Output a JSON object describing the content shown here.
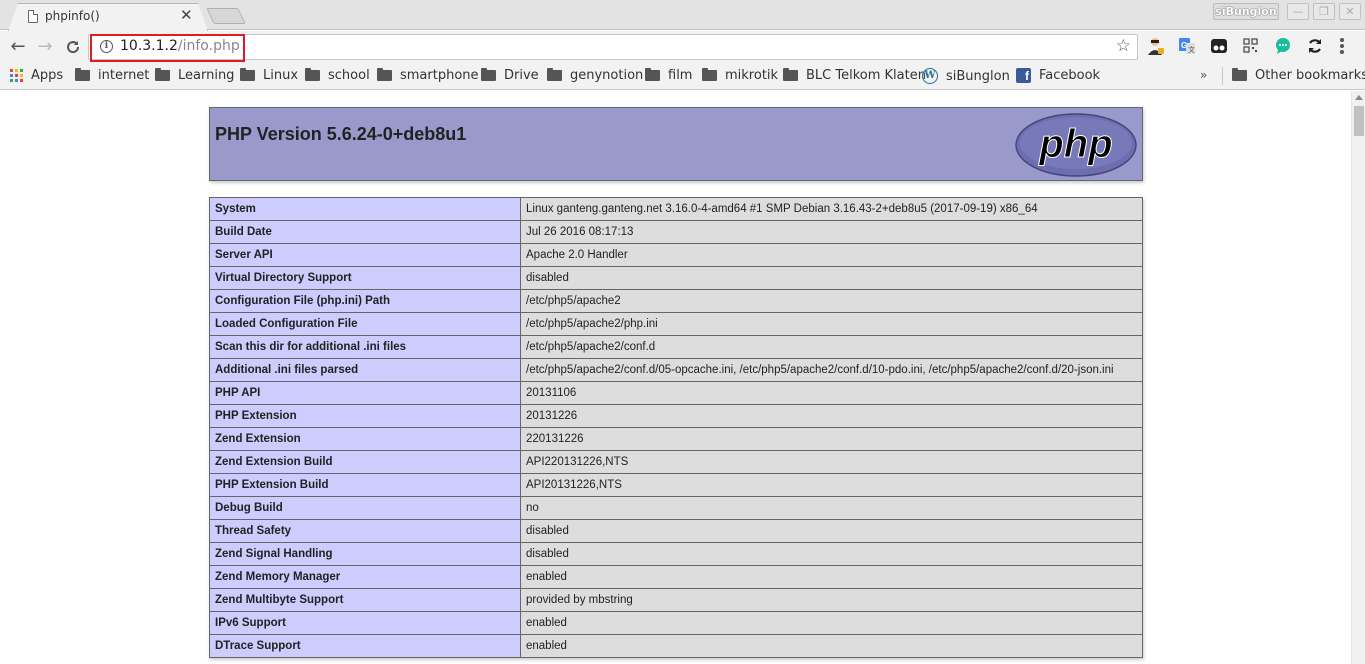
{
  "browser": {
    "tab": {
      "title": "phpinfo()"
    },
    "profile_name": "siBunglon",
    "window_controls": {
      "minimize": "—",
      "restore": "❐",
      "close": "✕"
    },
    "nav": {
      "back": "←",
      "forward": "→",
      "reload": "C"
    },
    "address": {
      "host": "10.3.1.2",
      "path": "/info.php",
      "info_icon": "i"
    },
    "bookmark_star": "☆",
    "extensions": [
      {
        "name": "spy-extension-icon"
      },
      {
        "name": "google-translate-icon"
      },
      {
        "name": "tampermonkey-icon"
      },
      {
        "name": "qr-code-icon"
      },
      {
        "name": "chat-bubble-icon"
      },
      {
        "name": "sync-icon"
      }
    ],
    "bookmarks": [
      {
        "label": "Apps",
        "icon": "apps-grid-icon"
      },
      {
        "label": "internet",
        "icon": "folder-icon"
      },
      {
        "label": "Learning",
        "icon": "folder-icon"
      },
      {
        "label": "Linux",
        "icon": "folder-icon"
      },
      {
        "label": "school",
        "icon": "folder-icon"
      },
      {
        "label": "smartphone",
        "icon": "folder-icon"
      },
      {
        "label": "Drive",
        "icon": "folder-icon"
      },
      {
        "label": "genynotion",
        "icon": "folder-icon"
      },
      {
        "label": "film",
        "icon": "folder-icon"
      },
      {
        "label": "mikrotik",
        "icon": "folder-icon"
      },
      {
        "label": "BLC Telkom Klaten",
        "icon": "folder-icon"
      },
      {
        "label": "siBunglon",
        "icon": "wordpress-icon"
      },
      {
        "label": "Facebook",
        "icon": "facebook-icon"
      }
    ],
    "bookmarks_overflow": "»",
    "other_bookmarks": "Other bookmarks",
    "colors": {
      "highlight_box": "#e11b22"
    }
  },
  "page": {
    "header_title": "PHP Version 5.6.24-0+deb8u1",
    "logo_text": "php",
    "colors": {
      "header_bg": "#9999cc",
      "key_bg": "#ccccff",
      "value_bg": "#dddddd"
    },
    "rows": [
      {
        "key": "System",
        "value": "Linux ganteng.ganteng.net 3.16.0-4-amd64 #1 SMP Debian 3.16.43-2+deb8u5 (2017-09-19) x86_64"
      },
      {
        "key": "Build Date",
        "value": "Jul 26 2016 08:17:13"
      },
      {
        "key": "Server API",
        "value": "Apache 2.0 Handler"
      },
      {
        "key": "Virtual Directory Support",
        "value": "disabled"
      },
      {
        "key": "Configuration File (php.ini) Path",
        "value": "/etc/php5/apache2"
      },
      {
        "key": "Loaded Configuration File",
        "value": "/etc/php5/apache2/php.ini"
      },
      {
        "key": "Scan this dir for additional .ini files",
        "value": "/etc/php5/apache2/conf.d"
      },
      {
        "key": "Additional .ini files parsed",
        "value": "/etc/php5/apache2/conf.d/05-opcache.ini, /etc/php5/apache2/conf.d/10-pdo.ini, /etc/php5/apache2/conf.d/20-json.ini"
      },
      {
        "key": "PHP API",
        "value": "20131106"
      },
      {
        "key": "PHP Extension",
        "value": "20131226"
      },
      {
        "key": "Zend Extension",
        "value": "220131226"
      },
      {
        "key": "Zend Extension Build",
        "value": "API220131226,NTS"
      },
      {
        "key": "PHP Extension Build",
        "value": "API20131226,NTS"
      },
      {
        "key": "Debug Build",
        "value": "no"
      },
      {
        "key": "Thread Safety",
        "value": "disabled"
      },
      {
        "key": "Zend Signal Handling",
        "value": "disabled"
      },
      {
        "key": "Zend Memory Manager",
        "value": "enabled"
      },
      {
        "key": "Zend Multibyte Support",
        "value": "provided by mbstring"
      },
      {
        "key": "IPv6 Support",
        "value": "enabled"
      },
      {
        "key": "DTrace Support",
        "value": "enabled"
      }
    ]
  }
}
